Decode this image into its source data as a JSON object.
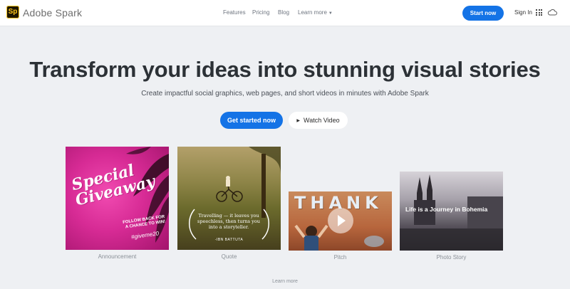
{
  "header": {
    "logo_text": "Sp",
    "brand": "Adobe Spark",
    "nav": [
      {
        "label": "Features"
      },
      {
        "label": "Pricing"
      },
      {
        "label": "Blog"
      },
      {
        "label": "Learn more"
      }
    ],
    "start_now": "Start now",
    "sign_in": "Sign In",
    "icons": [
      "logo-icon",
      "apps-grid-icon",
      "creative-cloud-icon"
    ]
  },
  "hero": {
    "title": "Transform your ideas into stunning visual stories",
    "subtitle": "Create impactful social graphics, web pages, and short videos in minutes with Adobe Spark",
    "primary_cta": "Get started now",
    "secondary_cta": "Watch Video"
  },
  "cards": [
    {
      "caption": "Announcement",
      "art_title": "Special Giveaway",
      "art_sub": "FOLLOW BACK FOR A CHANCE TO WIN!",
      "art_tag": "#giveme20"
    },
    {
      "caption": "Quote",
      "art_text": "Travelling — it leaves you speechless, then turns you into a storyteller.",
      "art_author": "-IBN BATTUTA"
    },
    {
      "caption": "Pitch",
      "art_text": "THANK"
    },
    {
      "caption": "Photo Story",
      "art_text": "Life is a Journey in Bohemia"
    }
  ],
  "footer": {
    "learn_more": "Learn more"
  },
  "colors": {
    "accent": "#1473e6",
    "background": "#eef0f3",
    "title": "#2c3136"
  }
}
